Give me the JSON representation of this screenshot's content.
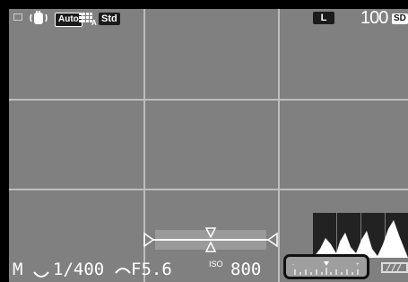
{
  "top_left": {
    "stabilizer_icon": "hand-shake-icon",
    "auto_label": "Auto",
    "af_area_icon": "af-grid-icon",
    "af_sub": "A",
    "image_mode": "Std"
  },
  "top_right": {
    "image_size": "L",
    "shots_remaining": "100",
    "card_label": "SD"
  },
  "bottom": {
    "exposure_mode": "M",
    "shutter_speed": "1/400",
    "aperture": "F5.6",
    "iso_label": "ISO",
    "iso_value": "800",
    "battery_icon": "battery-icon"
  },
  "colors": {
    "background": "#000000",
    "live_view": "#808080",
    "grid_line": "#bdbdbd",
    "highlight_border": "#111111"
  }
}
